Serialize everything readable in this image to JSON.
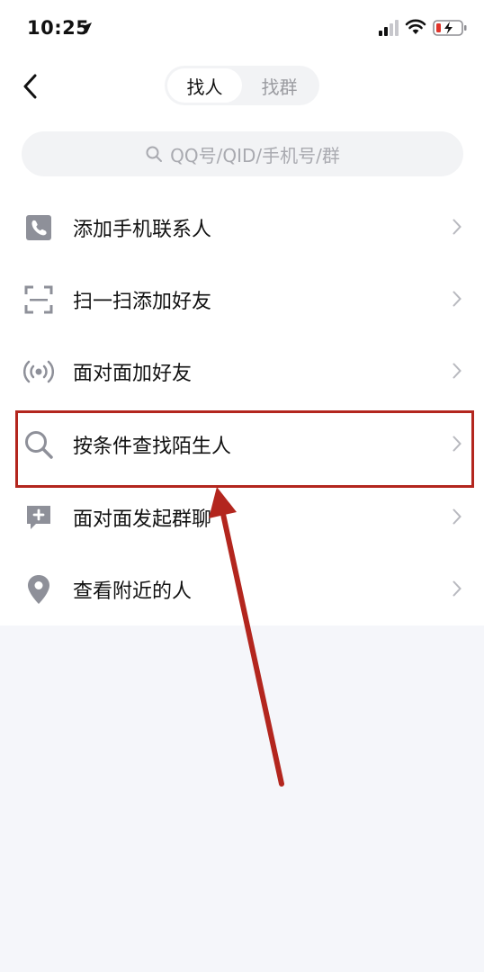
{
  "status_bar": {
    "time": "10:25",
    "location_icon": "location-arrow-icon",
    "signal_icon": "cellular-signal-icon",
    "wifi_icon": "wifi-icon",
    "battery_icon": "battery-charging-icon"
  },
  "header": {
    "back_icon": "chevron-left-icon",
    "tabs": [
      {
        "label": "找人",
        "active": true
      },
      {
        "label": "找群",
        "active": false
      }
    ]
  },
  "search": {
    "placeholder": "QQ号/QID/手机号/群",
    "icon": "search-icon"
  },
  "menu": {
    "items": [
      {
        "label": "添加手机联系人",
        "icon": "phone-icon"
      },
      {
        "label": "扫一扫添加好友",
        "icon": "scan-icon"
      },
      {
        "label": "面对面加好友",
        "icon": "radar-icon"
      },
      {
        "label": "按条件查找陌生人",
        "icon": "search-icon"
      },
      {
        "label": "面对面发起群聊",
        "icon": "chat-add-icon"
      },
      {
        "label": "查看附近的人",
        "icon": "location-pin-icon"
      }
    ]
  },
  "colors": {
    "annotation": "#b3261e",
    "icon": "#8e9099",
    "background": "#f5f6fa"
  }
}
